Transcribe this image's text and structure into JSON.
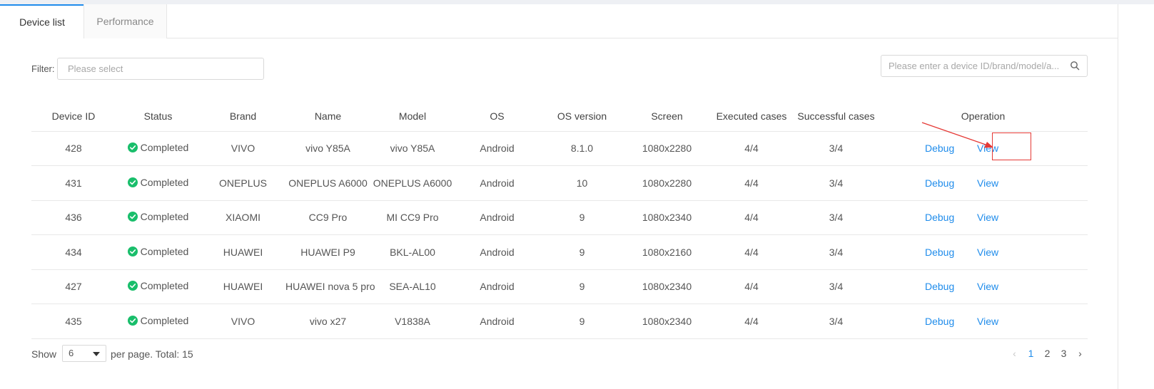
{
  "tabs": [
    {
      "label": "Device list",
      "active": true
    },
    {
      "label": "Performance",
      "active": false
    }
  ],
  "filter": {
    "label": "Filter:",
    "placeholder": "Please select"
  },
  "search": {
    "placeholder": "Please enter a device ID/brand/model/a..."
  },
  "table": {
    "columns": [
      "Device ID",
      "Status",
      "Brand",
      "Name",
      "Model",
      "OS",
      "OS version",
      "Screen",
      "Executed cases",
      "Successful cases",
      "Operation"
    ],
    "rows": [
      {
        "id": "428",
        "status": "Completed",
        "brand": "VIVO",
        "name": "vivo Y85A",
        "model": "vivo Y85A",
        "os": "Android",
        "os_version": "8.1.0",
        "screen": "1080x2280",
        "executed": "4/4",
        "successful": "3/4"
      },
      {
        "id": "431",
        "status": "Completed",
        "brand": "ONEPLUS",
        "name": "ONEPLUS A6000",
        "model": "ONEPLUS A6000",
        "os": "Android",
        "os_version": "10",
        "screen": "1080x2280",
        "executed": "4/4",
        "successful": "3/4"
      },
      {
        "id": "436",
        "status": "Completed",
        "brand": "XIAOMI",
        "name": "CC9 Pro",
        "model": "MI CC9 Pro",
        "os": "Android",
        "os_version": "9",
        "screen": "1080x2340",
        "executed": "4/4",
        "successful": "3/4"
      },
      {
        "id": "434",
        "status": "Completed",
        "brand": "HUAWEI",
        "name": "HUAWEI P9",
        "model": "BKL-AL00",
        "os": "Android",
        "os_version": "9",
        "screen": "1080x2160",
        "executed": "4/4",
        "successful": "3/4"
      },
      {
        "id": "427",
        "status": "Completed",
        "brand": "HUAWEI",
        "name": "HUAWEI nova 5 pro",
        "model": "SEA-AL10",
        "os": "Android",
        "os_version": "9",
        "screen": "1080x2340",
        "executed": "4/4",
        "successful": "3/4"
      },
      {
        "id": "435",
        "status": "Completed",
        "brand": "VIVO",
        "name": "vivo x27",
        "model": "V1838A",
        "os": "Android",
        "os_version": "9",
        "screen": "1080x2340",
        "executed": "4/4",
        "successful": "3/4"
      }
    ],
    "operations": {
      "debug": "Debug",
      "view": "View"
    }
  },
  "footer": {
    "show_label": "Show",
    "page_size": "6",
    "per_page_total": "per page.  Total: 15"
  },
  "pagination": {
    "prev": "‹",
    "pages": [
      "1",
      "2",
      "3"
    ],
    "current": "1",
    "next": "›"
  },
  "colors": {
    "accent": "#1f8ceb",
    "success": "#19be6b",
    "annotation": "#e53935"
  },
  "icons": {
    "search": "search-icon",
    "status": "check-circle-icon",
    "dropdown": "caret-down-icon",
    "annotation": "annotation-arrow-icon"
  }
}
